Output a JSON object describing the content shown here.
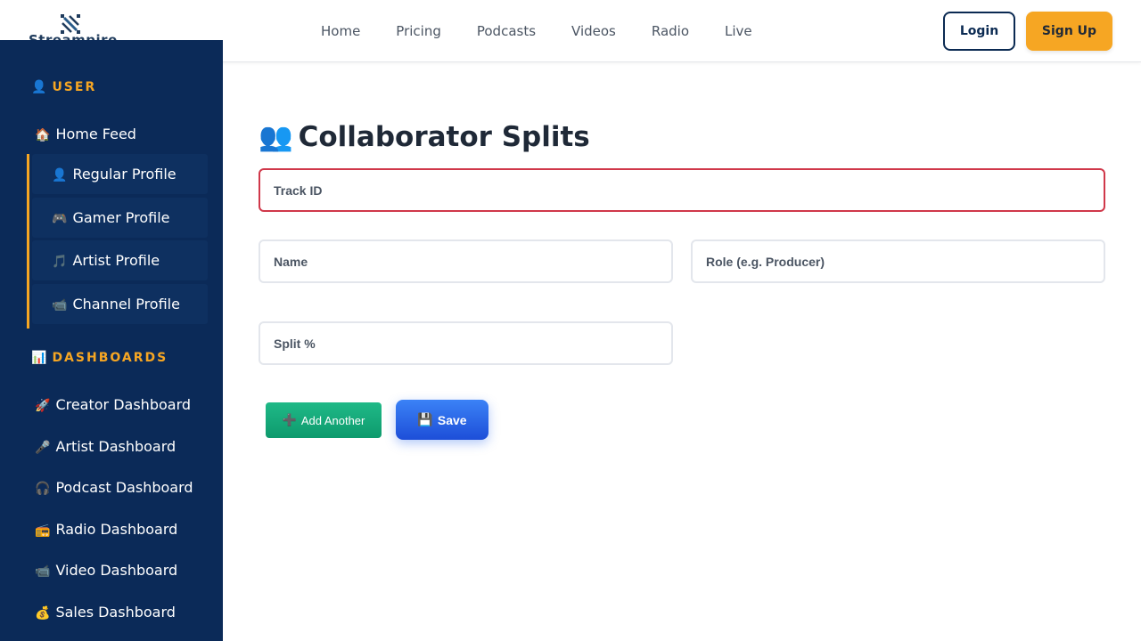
{
  "brand": {
    "name": "StreampireX"
  },
  "nav": {
    "items": [
      "Home",
      "Pricing",
      "Podcasts",
      "Videos",
      "Radio",
      "Live"
    ],
    "login_label": "Login",
    "signup_label": "Sign Up"
  },
  "sidebar": {
    "user_section": {
      "icon": "👤",
      "title": "USER"
    },
    "home_feed": {
      "icon": "🏠",
      "label": "Home Feed"
    },
    "profiles": [
      {
        "icon": "👤",
        "label": "Regular Profile"
      },
      {
        "icon": "🎮",
        "label": "Gamer Profile"
      },
      {
        "icon": "🎵",
        "label": "Artist Profile"
      },
      {
        "icon": "📹",
        "label": "Channel Profile"
      }
    ],
    "dashboards_section": {
      "icon": "📊",
      "title": "DASHBOARDS"
    },
    "dashboards": [
      {
        "icon": "🚀",
        "label": "Creator Dashboard"
      },
      {
        "icon": "🎤",
        "label": "Artist Dashboard"
      },
      {
        "icon": "🎧",
        "label": "Podcast Dashboard"
      },
      {
        "icon": "📻",
        "label": "Radio Dashboard"
      },
      {
        "icon": "📹",
        "label": "Video Dashboard"
      },
      {
        "icon": "💰",
        "label": "Sales Dashboard"
      }
    ]
  },
  "main": {
    "title_icon": "👥",
    "title": "Collaborator Splits",
    "fields": {
      "track_id": {
        "placeholder": "Track ID",
        "value": ""
      },
      "name": {
        "placeholder": "Name",
        "value": ""
      },
      "role": {
        "placeholder": "Role (e.g. Producer)",
        "value": ""
      },
      "split": {
        "placeholder": "Split %",
        "value": ""
      }
    },
    "add_button": {
      "icon": "➕",
      "label": "Add Another"
    },
    "save_button": {
      "icon": "💾",
      "label": "Save"
    }
  },
  "colors": {
    "sidebar_bg": "#0b2a58",
    "accent": "#f6a623",
    "primary": "#2563eb",
    "success": "#10b981",
    "error": "#d0384a"
  }
}
